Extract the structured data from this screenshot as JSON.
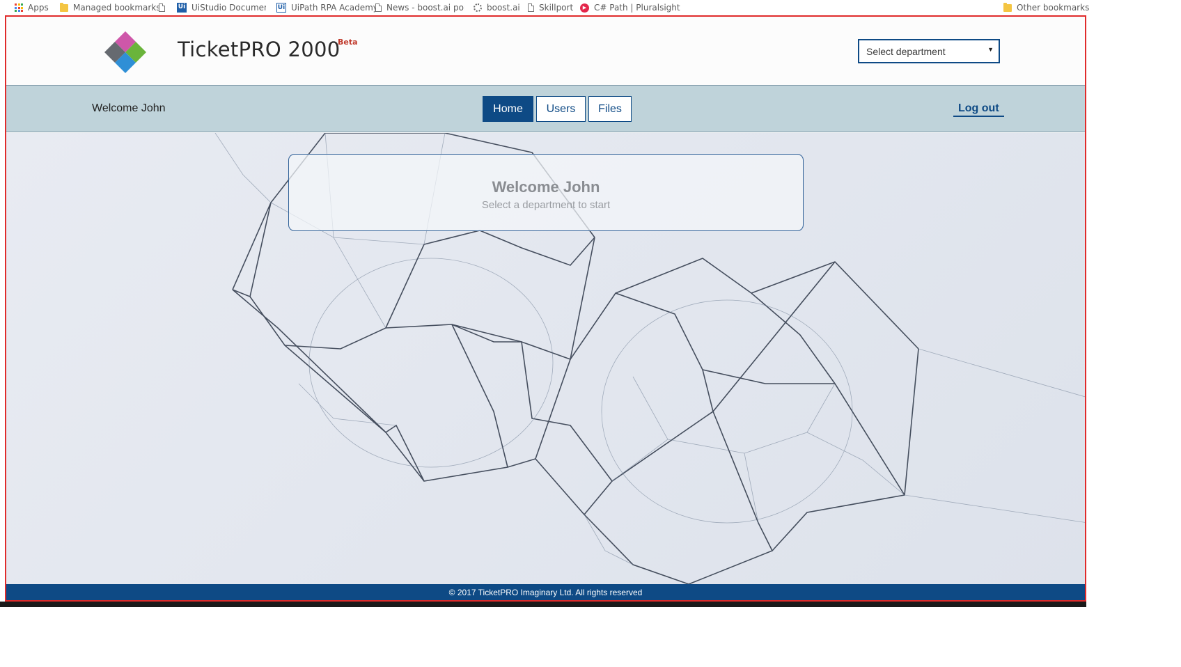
{
  "bookmarks": {
    "items": [
      {
        "label": "Apps",
        "icon": "apps-grid-icon"
      },
      {
        "label": "Managed bookmarks",
        "icon": "folder-icon"
      },
      {
        "label": "UiStudio Documentat",
        "icon": "uipath-icon"
      },
      {
        "label": "UiPath RPA Academy",
        "icon": "uipath-outline-icon"
      },
      {
        "label": "News - boost.ai porta",
        "icon": "page-icon"
      },
      {
        "label": "boost.ai",
        "icon": "gear-icon"
      },
      {
        "label": "Skillport",
        "icon": "page-icon"
      },
      {
        "label": "C# Path | Pluralsight",
        "icon": "pluralsight-icon"
      }
    ],
    "other": {
      "label": "Other bookmarks",
      "icon": "folder-icon"
    }
  },
  "header": {
    "title": "TicketPRO 2000",
    "badge": "Beta",
    "department_select": {
      "value": "Select department"
    }
  },
  "nav": {
    "welcome": "Welcome John",
    "tabs": [
      {
        "label": "Home",
        "active": true
      },
      {
        "label": "Users",
        "active": false
      },
      {
        "label": "Files",
        "active": false
      }
    ],
    "logout": "Log out"
  },
  "main": {
    "card_title": "Welcome John",
    "card_subtitle": "Select a department to start"
  },
  "footer": {
    "text": "© 2017 TicketPRO Imaginary Ltd. All rights reserved"
  },
  "colors": {
    "primary": "#0e4a85",
    "nav_bg": "#bfd3da",
    "frame_border": "#e02b2b",
    "beta": "#c0392b"
  }
}
